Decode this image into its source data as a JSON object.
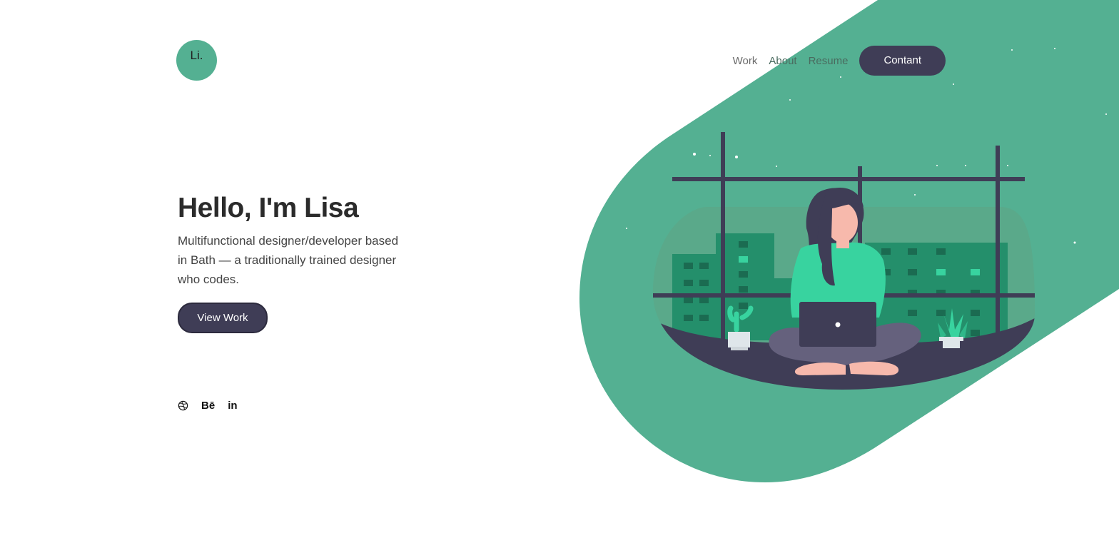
{
  "logo": {
    "text": "Li."
  },
  "nav": {
    "items": [
      {
        "label": "Work"
      },
      {
        "label": "About"
      },
      {
        "label": "Resume"
      }
    ],
    "cta": "Contant"
  },
  "hero": {
    "title": "Hello, I'm Lisa",
    "description": "Multifunctional designer/developer based in Bath — a traditionally trained designer who codes.",
    "button": "View Work"
  },
  "socials": [
    {
      "icon": "dribbble-icon"
    },
    {
      "icon": "behance-icon",
      "text": "Bē"
    },
    {
      "icon": "linkedin-icon",
      "text": "in"
    }
  ],
  "colors": {
    "accent": "#54b092",
    "dark": "#3f3d56",
    "bright_green": "#38d39f",
    "building": "#248f6b",
    "skin": "#f7b9ac"
  }
}
